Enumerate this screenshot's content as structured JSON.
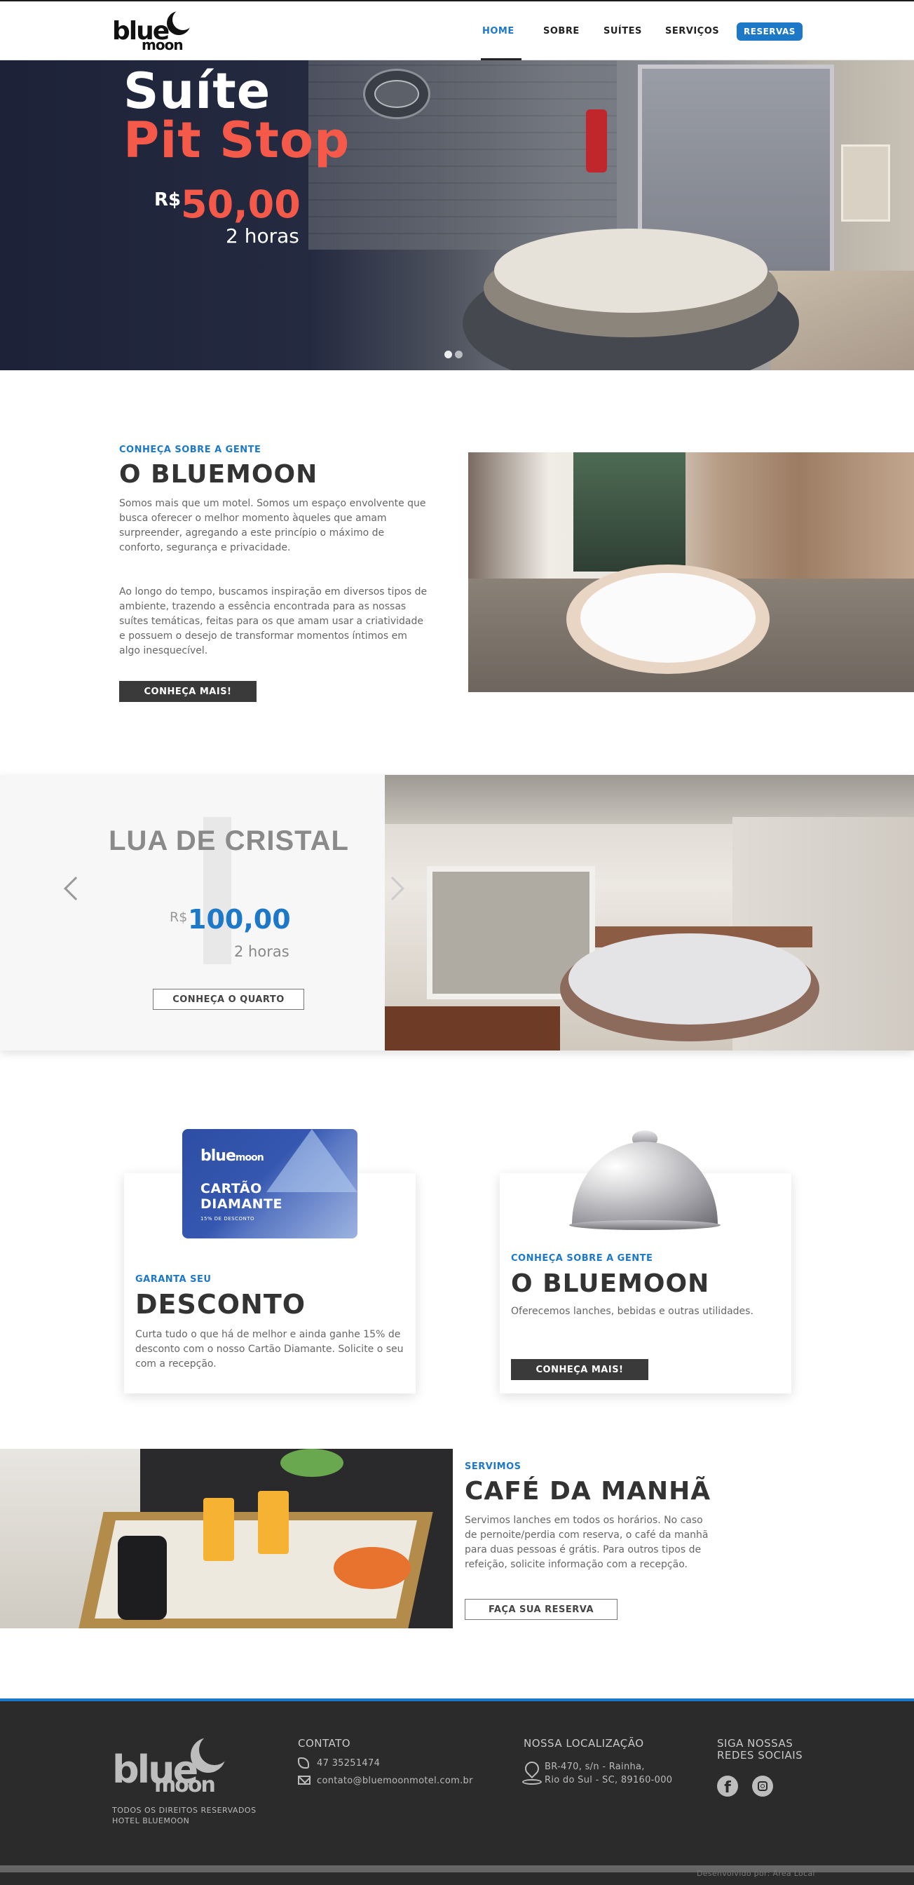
{
  "header": {
    "logo_word1": "blue",
    "logo_word2": "moon",
    "nav": {
      "home": "HOME",
      "sobre": "SOBRE",
      "suites": "SUÍTES",
      "servicos": "SERVIÇOS"
    },
    "reserve_label": "RESERVAS"
  },
  "hero": {
    "title_line1": "Suíte",
    "title_line2": "Pit Stop",
    "currency": "R$",
    "price": "50,00",
    "duration": "2 horas",
    "slide_count": 2,
    "active_slide": 1
  },
  "about": {
    "kicker": "CONHEÇA SOBRE A GENTE",
    "title": "O BLUEMOON",
    "paragraph1": "Somos mais que um motel. Somos um espaço envolvente que busca oferecer o melhor momento àqueles que amam surpreender, agregando a este princípio o máximo de conforto, segurança e privacidade.",
    "paragraph2": "Ao longo do tempo, buscamos inspiração em diversos tipos de ambiente, trazendo a essência encontrada para as nossas suítes temáticas, feitas para os que amam usar a criatividade e possuem o desejo de transformar momentos íntimos em algo inesquecível.",
    "button": "CONHEÇA MAIS!"
  },
  "room": {
    "name": "LUA DE CRISTAL",
    "currency": "R$",
    "price": "100,00",
    "duration": "2 horas",
    "button": "CONHEÇA O QUARTO"
  },
  "discount_card": {
    "card_logo1": "blue",
    "card_logo2": "moon",
    "card_line1": "CARTÃO",
    "card_line2": "DIAMANTE",
    "card_line3": "15% DE DESCONTO",
    "kicker": "GARANTA SEU",
    "title": "DESCONTO",
    "text": "Curta tudo o que há de melhor e ainda ganhe 15% de desconto com o nosso Cartão Diamante. Solicite o seu com a recepção."
  },
  "services_card": {
    "kicker": "CONHEÇA SOBRE A GENTE",
    "title": "O BLUEMOON",
    "text": "Oferecemos lanches, bebidas e outras utilidades.",
    "button": "CONHEÇA MAIS!"
  },
  "breakfast": {
    "kicker": "SERVIMOS",
    "title": "CAFÉ DA MANHÃ",
    "text": "Servimos lanches em todos os horários. No caso de pernoite/perdia com reserva, o café da manhã para duas pessoas é grátis. Para outros tipos de refeição, solicite informação com a recepção.",
    "button": "FAÇA SUA RESERVA"
  },
  "footer": {
    "logo_word1": "blue",
    "logo_word2": "moon",
    "rights_line1": "TODOS OS DIREITOS RESERVADOS",
    "rights_line2": "HOTEL BLUEMOON",
    "contact_heading": "CONTATO",
    "phone": "47 35251474",
    "email": "contato@bluemoonmotel.com.br",
    "location_heading": "NOSSA LOCALIZAÇÃO",
    "address_line1": "BR-470, s/n - Rainha,",
    "address_line2": "Rio do Sul - SC, 89160-000",
    "social_heading": "SIGA NOSSAS REDES SOCIAIS",
    "developer": "Desenvolvido por: Área Local"
  },
  "colors": {
    "accent": "#1d78c8",
    "highlight": "#f4594a",
    "dark": "#3a3a3a",
    "footer": "#2b2b2b"
  },
  "icons": [
    "moon-logo-icon",
    "chevron-left-icon",
    "chevron-right-icon",
    "phone-icon",
    "mail-icon",
    "location-pin-icon",
    "facebook-icon",
    "instagram-icon"
  ]
}
